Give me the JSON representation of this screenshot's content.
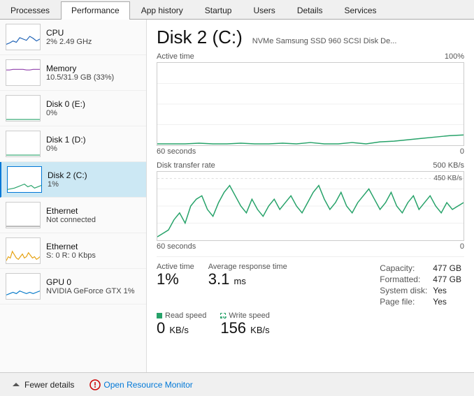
{
  "tabs": [
    {
      "label": "Processes",
      "active": false
    },
    {
      "label": "Performance",
      "active": true
    },
    {
      "label": "App history",
      "active": false
    },
    {
      "label": "Startup",
      "active": false
    },
    {
      "label": "Users",
      "active": false
    },
    {
      "label": "Details",
      "active": false
    },
    {
      "label": "Services",
      "active": false
    }
  ],
  "sidebar": {
    "items": [
      {
        "id": "cpu",
        "label": "CPU",
        "value": "2% 2.49 GHz",
        "chartColor": "#00a",
        "active": false
      },
      {
        "id": "memory",
        "label": "Memory",
        "value": "10.5/31.9 GB (33%)",
        "chartColor": "#a0a",
        "active": false
      },
      {
        "id": "disk0",
        "label": "Disk 0 (E:)",
        "value": "0%",
        "chartColor": "#0a0",
        "active": false
      },
      {
        "id": "disk1",
        "label": "Disk 1 (D:)",
        "value": "0%",
        "chartColor": "#0a0",
        "active": false
      },
      {
        "id": "disk2",
        "label": "Disk 2 (C:)",
        "value": "1%",
        "chartColor": "#0a0",
        "active": true
      },
      {
        "id": "ethernet0",
        "label": "Ethernet",
        "value": "Not connected",
        "chartColor": "#888",
        "active": false
      },
      {
        "id": "ethernet1",
        "label": "Ethernet",
        "value": "S: 0 R: 0 Kbps",
        "chartColor": "#c80",
        "active": false
      },
      {
        "id": "gpu0",
        "label": "GPU 0",
        "value": "NVIDIA GeForce GTX\n1%",
        "chartColor": "#07a",
        "active": false
      }
    ]
  },
  "content": {
    "disk_title": "Disk 2 (C:)",
    "disk_subtitle": "NVMe Samsung SSD 960 SCSI Disk De...",
    "chart1": {
      "label_left": "Active time",
      "label_right": "100%",
      "time_left": "60 seconds",
      "time_right": "0"
    },
    "chart2": {
      "label_left": "Disk transfer rate",
      "label_right": "500 KB/s",
      "time_left": "60 seconds",
      "time_right": "0",
      "right_label": "450 KB/s"
    },
    "stats": {
      "active_time_label": "Active time",
      "active_time_value": "1%",
      "avg_response_label": "Average response time",
      "avg_response_value": "3.1",
      "avg_response_unit": "ms",
      "capacity_label": "Capacity:",
      "capacity_value": "477 GB",
      "formatted_label": "Formatted:",
      "formatted_value": "477 GB",
      "system_disk_label": "System disk:",
      "system_disk_value": "Yes",
      "page_file_label": "Page file:",
      "page_file_value": "Yes"
    },
    "speeds": {
      "read_label": "Read speed",
      "read_value": "0",
      "read_unit": "KB/s",
      "write_label": "Write speed",
      "write_value": "156",
      "write_unit": "KB/s"
    }
  },
  "bottom": {
    "fewer_details": "Fewer details",
    "open_monitor": "Open Resource Monitor"
  }
}
